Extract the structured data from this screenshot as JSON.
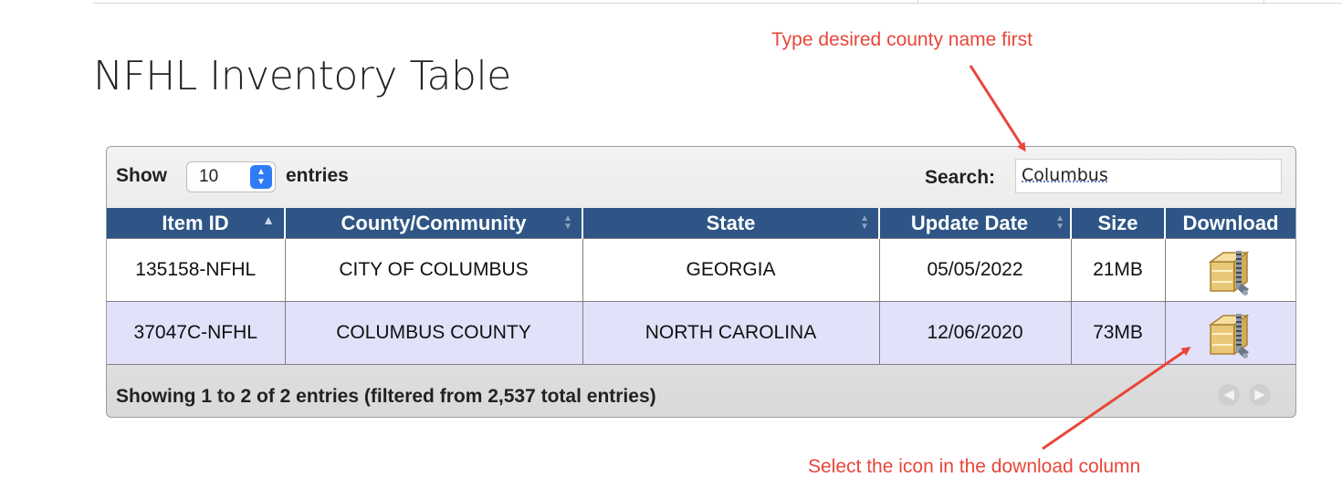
{
  "page_title": "NFHL Inventory Table",
  "annotations": {
    "top": "Type desired county name first",
    "bottom": "Select the icon in the download column"
  },
  "toolbar": {
    "show_label": "Show",
    "page_size": "10",
    "entries_label": "entries",
    "search_label": "Search:",
    "search_value": "Columbus"
  },
  "table": {
    "columns": [
      "Item ID",
      "County/Community",
      "State",
      "Update Date",
      "Size",
      "Download"
    ],
    "rows": [
      {
        "item_id": "135158-NFHL",
        "county": "CITY OF COLUMBUS",
        "state": "GEORGIA",
        "update_date": "05/05/2022",
        "size": "21MB",
        "download_icon": "zip-archive-icon"
      },
      {
        "item_id": "37047C-NFHL",
        "county": "COLUMBUS COUNTY",
        "state": "NORTH CAROLINA",
        "update_date": "12/06/2020",
        "size": "73MB",
        "download_icon": "zip-archive-icon"
      }
    ]
  },
  "footer": {
    "info": "Showing 1 to 2 of 2 entries (filtered from 2,537 total entries)"
  },
  "colors": {
    "header_bg": "#2e5585",
    "alt_row_bg": "#e1e1fa",
    "annotation": "#e8463a"
  }
}
